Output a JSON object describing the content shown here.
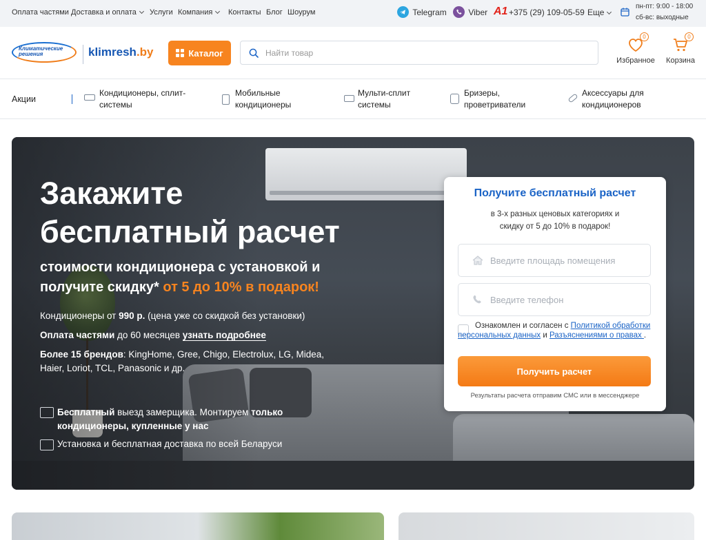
{
  "topbar": {
    "links": [
      "Оплата частями",
      "Доставка и оплата",
      "Услуги",
      "Компания",
      "Контакты",
      "Блог",
      "Шоурум"
    ],
    "messengers": {
      "telegram": "Telegram",
      "viber": "Viber"
    },
    "operator_logo": "A1",
    "phone": "+375 (29) 109-05-59",
    "more_label": "Еще",
    "hours_weekdays": "пн-пт: 9:00 - 18:00",
    "hours_weekend": "сб-вс: выходные"
  },
  "header": {
    "logo_emblem_text": "Климатические решения",
    "logo_name": "klimresh",
    "logo_tld": ".by",
    "catalog_label": "Каталог",
    "search_placeholder": "Найти товар",
    "favorites_label": "Избранное",
    "favorites_count": "0",
    "cart_label": "Корзина",
    "cart_count": "0"
  },
  "nav": {
    "promo": "Акции",
    "items": [
      {
        "line1": "Кондиционеры, сплит-",
        "line2": "системы",
        "icon": "split-ac-icon"
      },
      {
        "line1": "Мобильные",
        "line2": "кондиционеры",
        "icon": "mobile-ac-icon"
      },
      {
        "line1": "Мульти-сплит",
        "line2": "системы",
        "icon": "multi-split-icon"
      },
      {
        "line1": "Бризеры,",
        "line2": "проветриватели",
        "icon": "breezer-icon"
      },
      {
        "line1": "Аксессуары для",
        "line2": "кондиционеров",
        "icon": "accessories-icon"
      }
    ]
  },
  "hero": {
    "title_line1": "Закажите",
    "title_line2": "бесплатный расчет",
    "subtitle_line1": "стоимости кондиционера с установкой и",
    "subtitle_line2_a": "получите скидку* ",
    "subtitle_line2_b": "от 5 до 10% в подарок!",
    "price_a": "Кондиционеры от ",
    "price_b": "990 р.",
    "price_c": " (цена уже со скидкой без установки)",
    "installment_a": "Оплата частями",
    "installment_b": " до 60 месяцев ",
    "installment_link": "узнать подробнее",
    "brands_a": "Более 15 брендов",
    "brands_b": ": KingHome, Gree, Chigo, Electrolux, LG, Midea,",
    "brands_line2": "Haier, Loriot, TCL, Panasonic и др.",
    "feature1_a": "Бесплатный",
    "feature1_b": " выезд замерщика. Монтируем ",
    "feature1_c": "только",
    "feature1_line2": "кондиционеры, купленные у нас",
    "feature2": "Установка и бесплатная доставка по всей Беларуси"
  },
  "form": {
    "title": "Получите бесплатный расчет",
    "desc_line1": "в 3-х разных ценовых категориях и",
    "desc_line2": "скидку от 5 до 10% в подарок!",
    "area_placeholder": "Введите площадь помещения",
    "phone_placeholder": "Введите телефон",
    "agree_a": "Ознакомлен и согласен с ",
    "agree_link1": "Политикой обработки персональных данных",
    "agree_b": " и ",
    "agree_link2": "Разъяснениями о правах ",
    "agree_c": ".",
    "submit_label": "Получить расчет",
    "note": "Результаты расчета отправим СМС или в мессенджере"
  },
  "colors": {
    "accent": "#f7841f",
    "brand_blue": "#1a63c6",
    "topbar_bg": "#f1f3f6"
  }
}
